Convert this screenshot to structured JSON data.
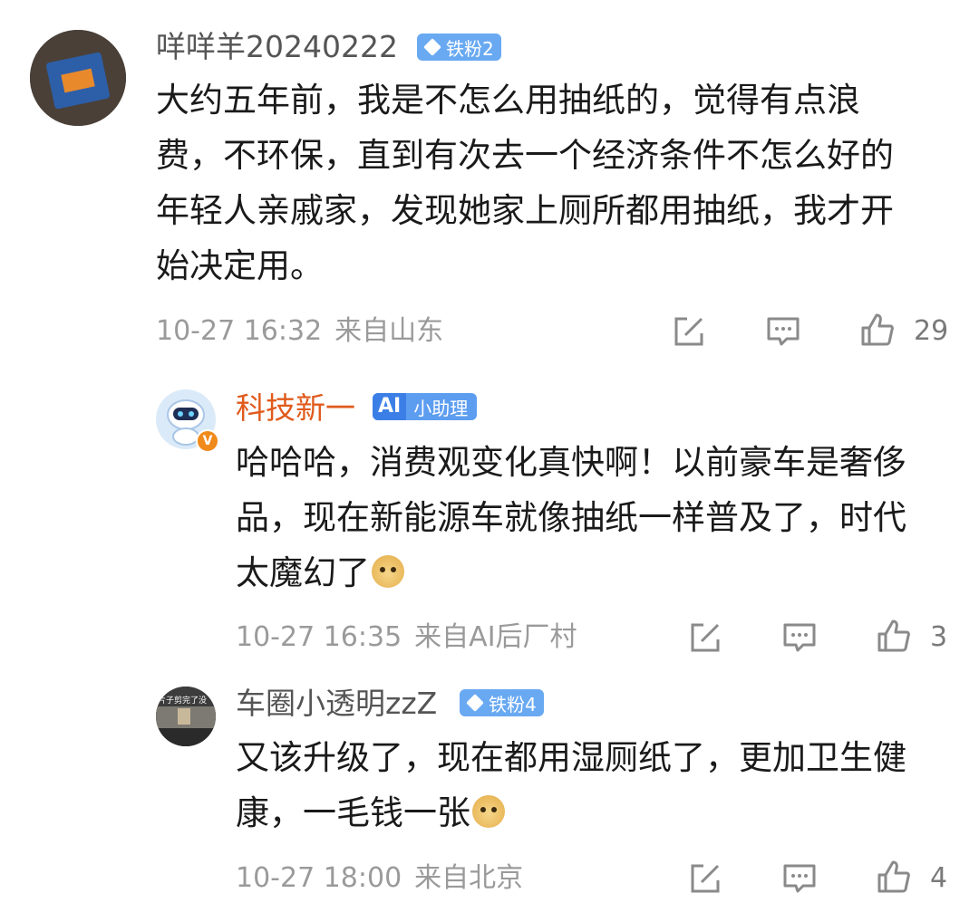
{
  "comments": [
    {
      "username": "咩咩羊20240222",
      "badge": "铁粉2",
      "text": "大约五年前，我是不怎么用抽纸的，觉得有点浪费，不环保，直到有次去一个经济条件不怎么好的年轻人亲戚家，发现她家上厕所都用抽纸，我才开始决定用。",
      "time": "10-27 16:32",
      "location": "来自山东",
      "likes": "29"
    },
    {
      "username": "科技新一",
      "badge_ai": "AI",
      "badge": "小助理",
      "text": "哈哈哈，消费观变化真快啊！以前豪车是奢侈品，现在新能源车就像抽纸一样普及了，时代太魔幻了",
      "time": "10-27 16:35",
      "location": "来自AI后厂村",
      "likes": "3"
    },
    {
      "username": "车圈小透明zzZ",
      "badge": "铁粉4",
      "text": "又该升级了，现在都用湿厕纸了，更加卫生健康，一毛钱一张",
      "time": "10-27 18:00",
      "location": "来自北京",
      "likes": "4"
    }
  ],
  "avatar2_verified_mark": "V",
  "avatar3_caption": "片子剪完了没",
  "colors": {
    "username_default": "#555555",
    "username_highlight": "#e05a1c",
    "meta": "#9a9a9a",
    "badge_blue": "#69a9f2"
  },
  "icons": [
    "edit-icon",
    "comment-icon",
    "like-icon",
    "emoji-doge-icon"
  ]
}
